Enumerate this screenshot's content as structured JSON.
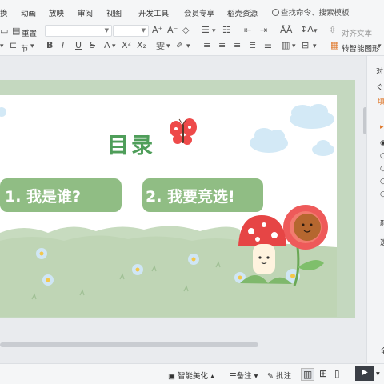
{
  "menu": {
    "items": [
      "换",
      "动画",
      "放映",
      "审阅",
      "视图",
      "开发工具",
      "会员专享",
      "稻壳资源"
    ],
    "search_placeholder": "查找命令、搜索模板"
  },
  "toolbar": {
    "reset_label": "重置",
    "section_label": "节",
    "align_text_label": "对齐文本",
    "smartart_label": "转智能图形"
  },
  "slide": {
    "title": "目录",
    "cards": [
      "1. 我是谁?",
      "2. 我要竞选!"
    ],
    "colors": {
      "title": "#4f9e5a",
      "card": "#90bd84",
      "slide_frame": "#c4d8bf"
    }
  },
  "right_panel": {
    "labels": [
      "对",
      "ぐ",
      "填",
      "颜",
      "透",
      "全"
    ]
  },
  "status": {
    "smart_beautify": "智能美化",
    "notes": "备注",
    "comments": "批注"
  }
}
